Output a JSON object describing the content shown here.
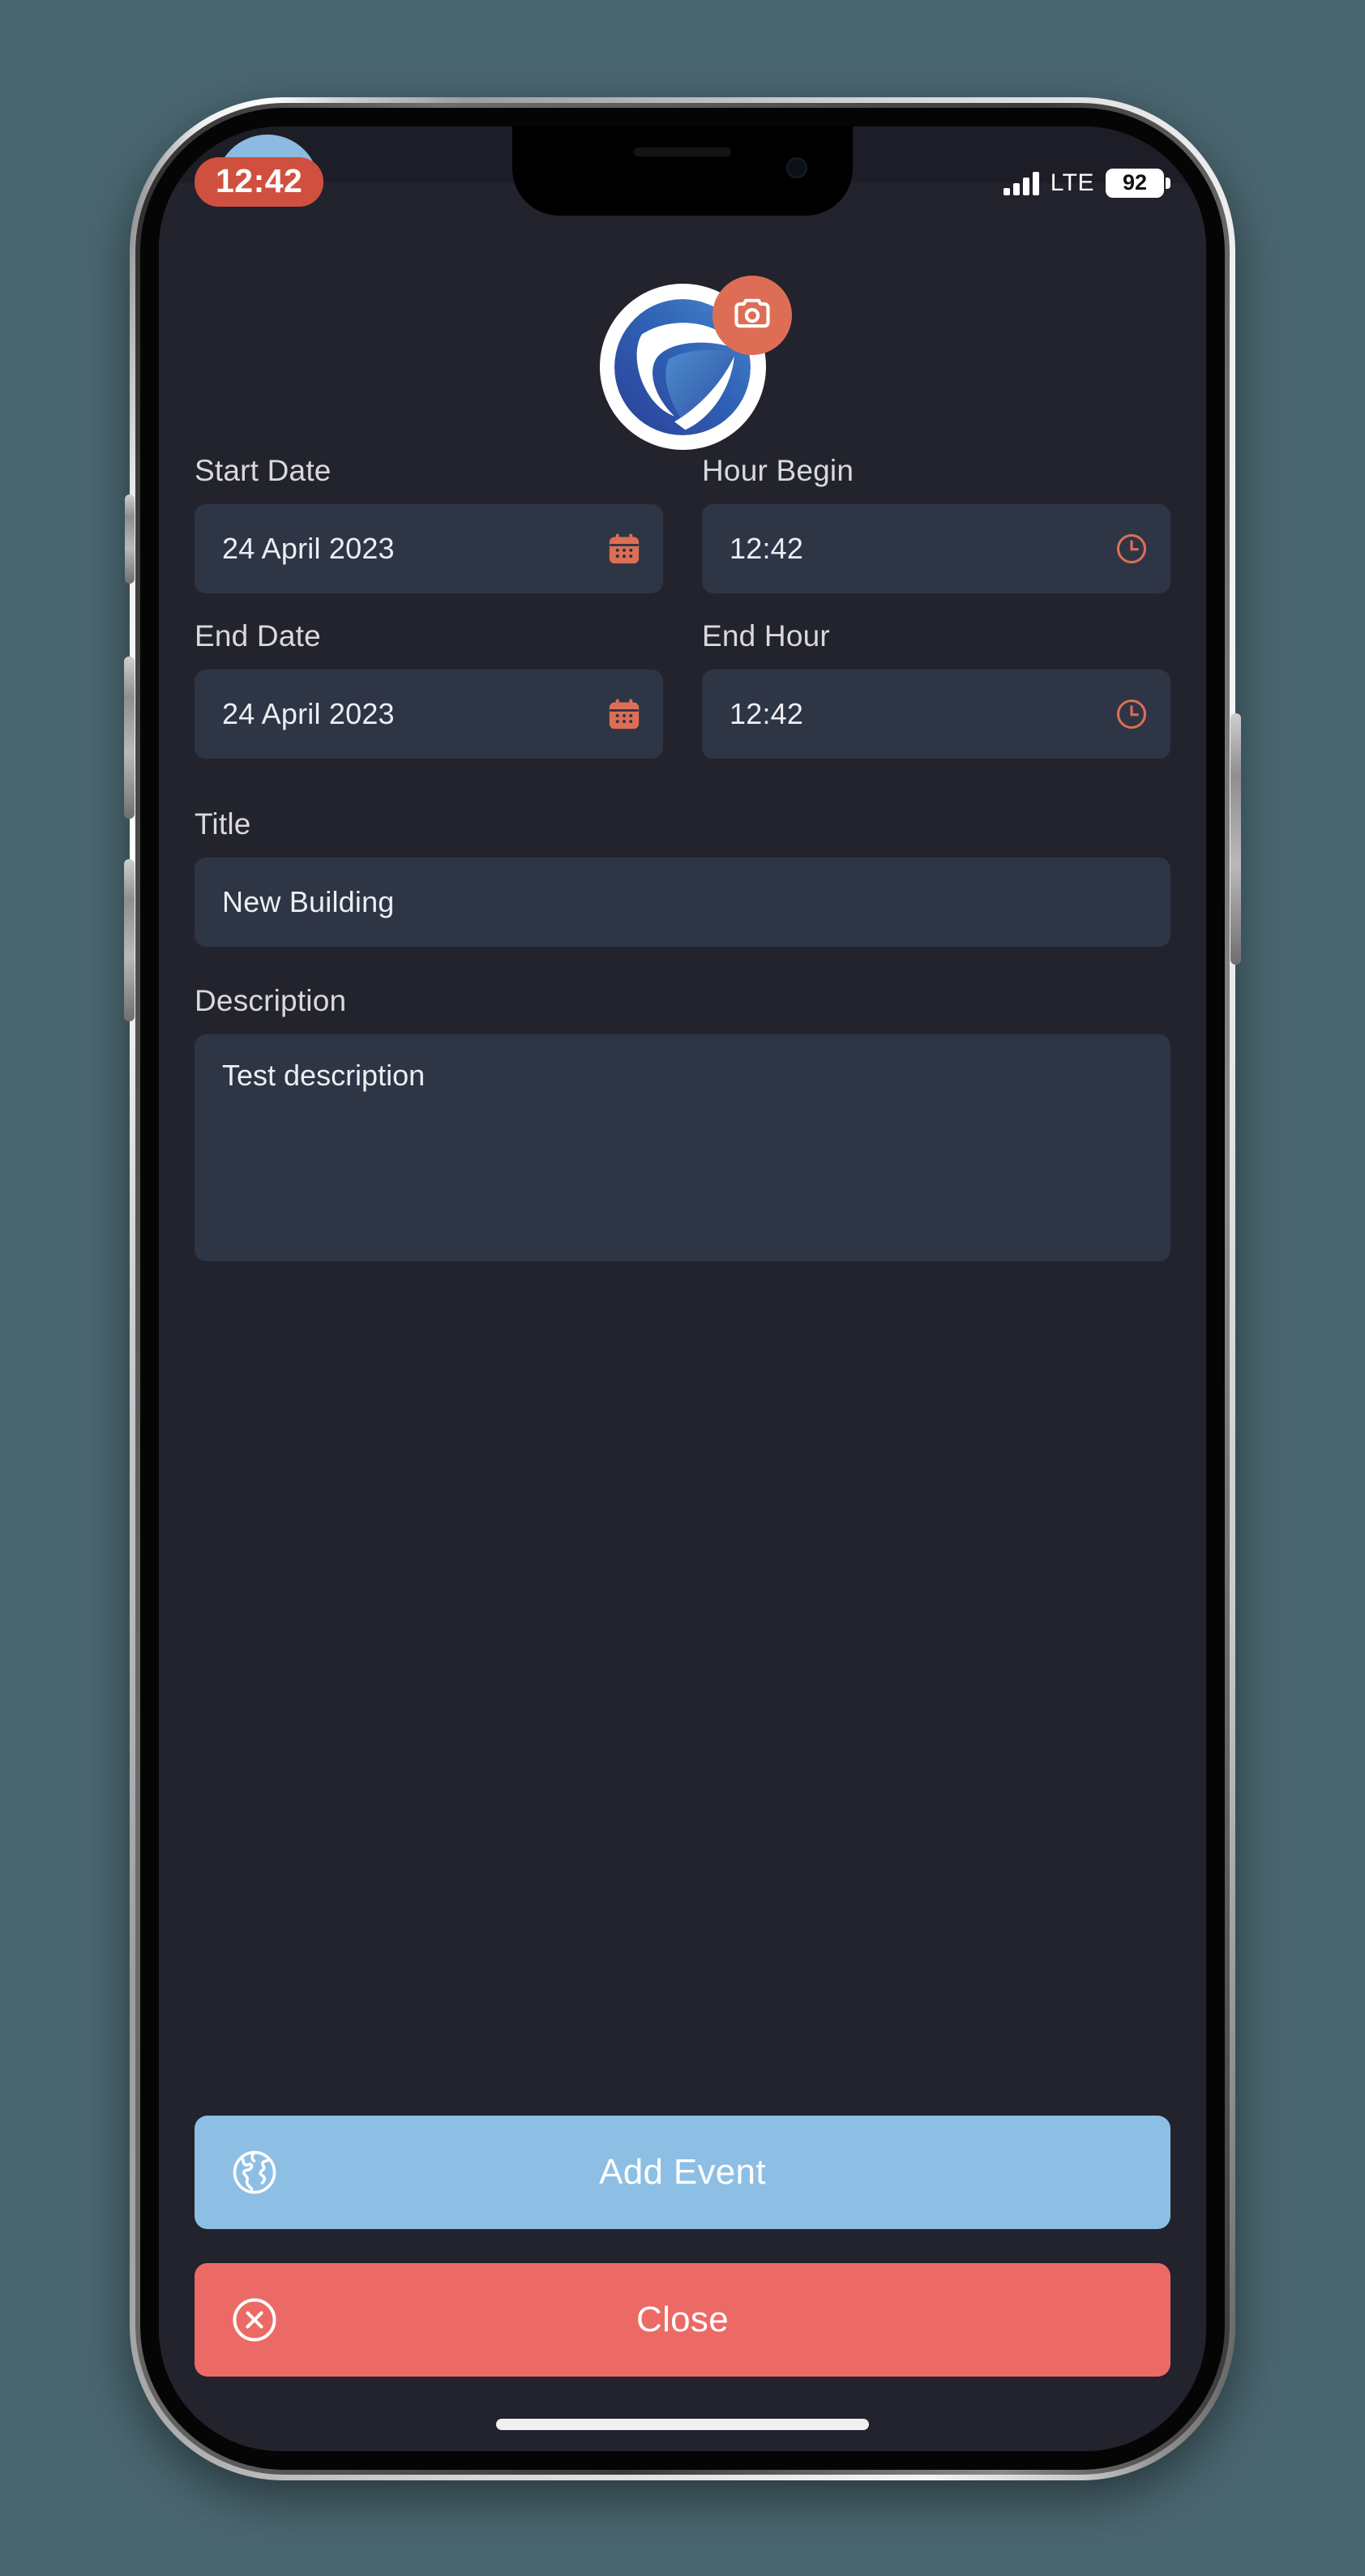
{
  "statusbar": {
    "time": "12:42",
    "network_label": "LTE",
    "battery_level": "92",
    "signal_icon": "cellular-signal-icon",
    "battery_icon": "battery-icon"
  },
  "branding": {
    "logo_icon": "app-logo-icon",
    "camera_badge_icon": "camera-icon"
  },
  "form": {
    "start_date": {
      "label": "Start Date",
      "value": "24 April 2023",
      "icon": "calendar-icon"
    },
    "hour_begin": {
      "label": "Hour Begin",
      "value": "12:42",
      "icon": "clock-icon"
    },
    "end_date": {
      "label": "End Date",
      "value": "24 April 2023",
      "icon": "calendar-icon"
    },
    "end_hour": {
      "label": "End Hour",
      "value": "12:42",
      "icon": "clock-icon"
    },
    "title": {
      "label": "Title",
      "value": "New Building",
      "placeholder": "Title"
    },
    "description": {
      "label": "Description",
      "value": "Test description",
      "placeholder": "Description"
    }
  },
  "actions": {
    "add_event": {
      "label": "Add Event",
      "icon": "globe-icon"
    },
    "close": {
      "label": "Close",
      "icon": "close-circle-icon"
    }
  },
  "colors": {
    "page_background": "#4a6670",
    "sheet_background": "#23232e",
    "input_background": "#2e3545",
    "accent_orange": "#dd6e55",
    "accent_blue": "#8dbfe4",
    "accent_red": "#ec6a66",
    "time_pill": "#d0503f"
  }
}
